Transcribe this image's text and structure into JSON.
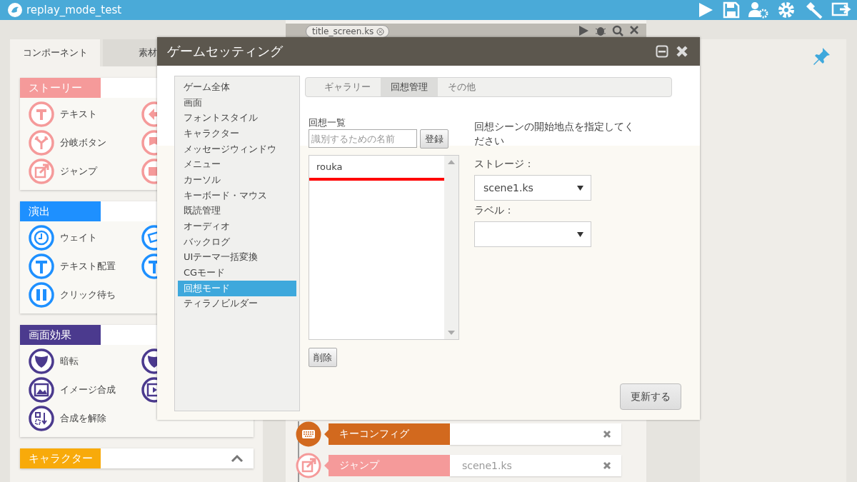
{
  "app": {
    "title": "replay_mode_test"
  },
  "left_panel": {
    "tabs": [
      {
        "label": "コンポーネント",
        "selected": true
      },
      {
        "label": "素材",
        "selected": false
      }
    ],
    "sections": [
      {
        "title": "ストーリー",
        "color": "#f59a9a",
        "items": [
          "テキスト",
          "分岐ボタン",
          "ジャンプ"
        ]
      },
      {
        "title": "演出",
        "color": "#1e90ff",
        "items": [
          "ウェイト",
          "テキスト配置",
          "クリック待ち"
        ]
      },
      {
        "title": "画面効果",
        "color": "#4b3a8e",
        "items": [
          "暗転",
          "イメージ合成",
          "合成を解除"
        ]
      },
      {
        "title": "キャラクター",
        "color": "#f8aa0a"
      }
    ]
  },
  "script_panel": {
    "file_tab": "title_screen.ks",
    "timeline": [
      {
        "label": "キーコンフィグ",
        "color": "#d2691e"
      },
      {
        "label": "ジャンプ",
        "color": "#f59a9a",
        "value": "scene1.ks"
      }
    ]
  },
  "dialog": {
    "title": "ゲームセッティング",
    "sidebar": [
      {
        "label": "ゲーム全体",
        "selected": false
      },
      {
        "label": "画面",
        "selected": false
      },
      {
        "label": "フォントスタイル",
        "selected": false
      },
      {
        "label": "キャラクター",
        "selected": false
      },
      {
        "label": "メッセージウィンドウ",
        "selected": false
      },
      {
        "label": "メニュー",
        "selected": false
      },
      {
        "label": "カーソル",
        "selected": false
      },
      {
        "label": "キーボード・マウス",
        "selected": false
      },
      {
        "label": "既読管理",
        "selected": false
      },
      {
        "label": "オーディオ",
        "selected": false
      },
      {
        "label": "バックログ",
        "selected": false
      },
      {
        "label": "UIテーマ一括変換",
        "selected": false
      },
      {
        "label": "CGモード",
        "selected": false
      },
      {
        "label": "回想モード",
        "selected": true
      },
      {
        "label": "ティラノビルダー",
        "selected": false
      }
    ],
    "tabs": [
      {
        "label": "ギャラリー",
        "selected": false
      },
      {
        "label": "回想管理",
        "selected": true
      },
      {
        "label": "その他",
        "selected": false
      }
    ],
    "list_label": "回想一覧",
    "name_field": {
      "placeholder": "識別するための名前"
    },
    "register_button": "登録",
    "entries": [
      {
        "name": "rouka",
        "underlined": true
      }
    ],
    "delete_button": "削除",
    "hint": "回想シーンの開始地点を指定してください",
    "storage_label": "ストレージ：",
    "storage_value": "scene1.ks",
    "label_label": "ラベル：",
    "update_button": "更新する"
  }
}
